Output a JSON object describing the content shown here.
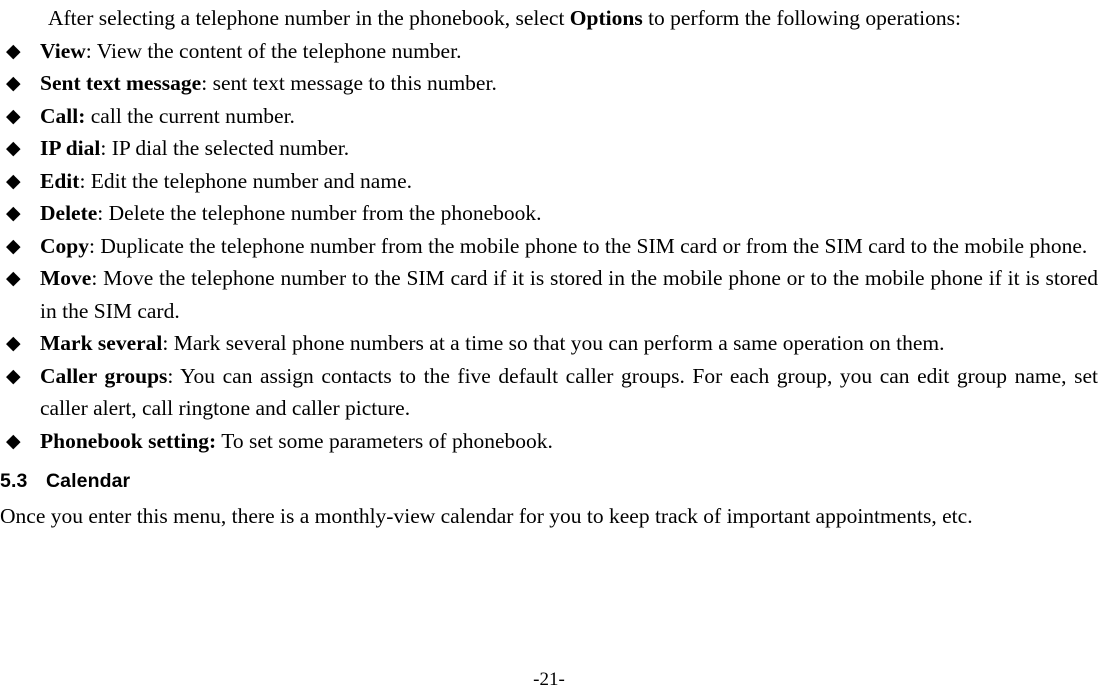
{
  "document": {
    "intro": {
      "before_bold": "After selecting a telephone number in the phonebook, select ",
      "bold": "Options",
      "after_bold": " to perform the following operations:"
    },
    "bullet_marker": "◆",
    "bullets": [
      {
        "term": "View",
        "separator": ": ",
        "text": "View the content of the telephone number."
      },
      {
        "term": "Sent text message",
        "separator": ": ",
        "text": "sent text message to this number."
      },
      {
        "term": "Call:",
        "separator": " ",
        "text": "call the current number."
      },
      {
        "term": "IP dial",
        "separator": ": ",
        "text": "IP dial the selected number."
      },
      {
        "term": "Edit",
        "separator": ": ",
        "text": "Edit the telephone number and name."
      },
      {
        "term": "Delete",
        "separator": ": ",
        "text": "Delete the telephone number from the phonebook."
      },
      {
        "term": "Copy",
        "separator": ": ",
        "text": "Duplicate the telephone number from the mobile phone to the SIM card or from the SIM card to the mobile phone."
      },
      {
        "term": "Move",
        "separator": ": ",
        "text": "Move the telephone number to the SIM card if it is stored in the mobile phone or to the mobile phone if it is stored in the SIM card."
      },
      {
        "term": "Mark several",
        "separator": ": ",
        "text": "Mark several phone numbers at a time so that you can perform a same operation on them."
      },
      {
        "term": "Caller groups",
        "separator": ": ",
        "text": "You can assign contacts to the five default caller groups. For each group, you can edit group name, set caller alert, call ringtone and caller picture."
      },
      {
        "term": "Phonebook setting:",
        "separator": " ",
        "text": "To set some parameters of phonebook."
      }
    ],
    "heading": {
      "number": "5.3",
      "title": "Calendar"
    },
    "closing": "Once you enter this menu, there is a monthly-view calendar for you to keep track of important appointments, etc.",
    "footer": {
      "page_label": "-21-"
    }
  }
}
